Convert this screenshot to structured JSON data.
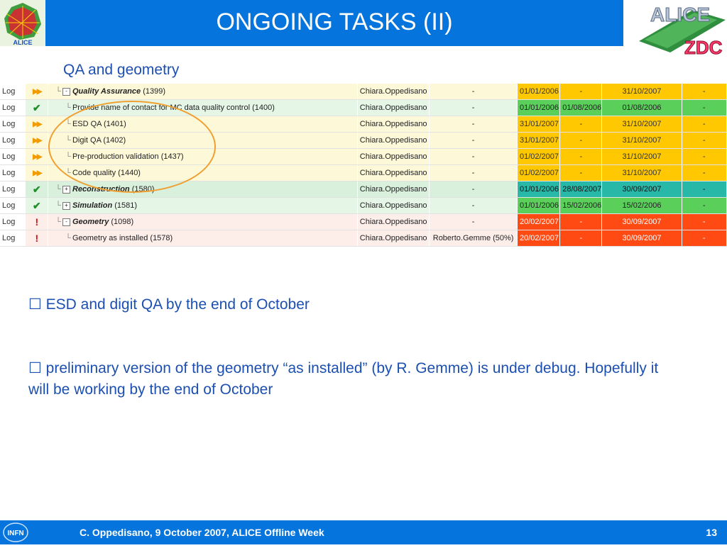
{
  "slide": {
    "title": "ONGOING TASKS (II)",
    "subtitle": "QA and geometry"
  },
  "logos": {
    "left_caption": "ALICE",
    "right_top": "ALICE",
    "right_bottom": "ZDC",
    "footer_logo": "INFN"
  },
  "colors": {
    "title_bar": "#0574dc",
    "text_blue": "#1c4fb1",
    "row_yellow": "#fdf8d8",
    "row_green": "#e6f6e6",
    "row_green_dark": "#d9f0dd",
    "row_pink": "#fdeeea",
    "date_yellow": "#ffc800",
    "date_green": "#5ad05a",
    "date_teal": "#28b8a8",
    "date_red": "#ff4a14"
  },
  "table": {
    "rows": [
      {
        "log": "Log",
        "icon": "fast-forward-icon",
        "indent": 0,
        "expand": "-",
        "name": "Quality Assurance",
        "id": "(1399)",
        "bold": true,
        "owner": "Chiara.Oppedisano",
        "assign": "-",
        "d1": "01/01/2006",
        "d2": "-",
        "d3": "31/10/2007",
        "d4": "-",
        "row_color": "#fdf8d8",
        "date_color": "#ffc800",
        "text_color": "#333333"
      },
      {
        "log": "Log",
        "icon": "check-icon",
        "indent": 1,
        "expand": "",
        "name": "Provide name of contact for MC data quality control",
        "id": "(1400)",
        "bold": false,
        "owner": "Chiara.Oppedisano",
        "assign": "-",
        "d1": "01/01/2006",
        "d2": "01/08/2006",
        "d3": "01/08/2006",
        "d4": "-",
        "row_color": "#e6f6e6",
        "date_color": "#5ad05a",
        "text_color": "#222222"
      },
      {
        "log": "Log",
        "icon": "fast-forward-icon",
        "indent": 1,
        "expand": "",
        "name": "ESD QA",
        "id": "(1401)",
        "bold": false,
        "owner": "Chiara.Oppedisano",
        "assign": "-",
        "d1": "31/01/2007",
        "d2": "-",
        "d3": "31/10/2007",
        "d4": "-",
        "row_color": "#fdf8d8",
        "date_color": "#ffc800",
        "text_color": "#333333"
      },
      {
        "log": "Log",
        "icon": "fast-forward-icon",
        "indent": 1,
        "expand": "",
        "name": "Digit QA",
        "id": "(1402)",
        "bold": false,
        "owner": "Chiara.Oppedisano",
        "assign": "-",
        "d1": "31/01/2007",
        "d2": "-",
        "d3": "31/10/2007",
        "d4": "-",
        "row_color": "#fdf8d8",
        "date_color": "#ffc800",
        "text_color": "#333333"
      },
      {
        "log": "Log",
        "icon": "fast-forward-icon",
        "indent": 1,
        "expand": "",
        "name": "Pre-production validation",
        "id": "(1437)",
        "bold": false,
        "owner": "Chiara.Oppedisano",
        "assign": "-",
        "d1": "01/02/2007",
        "d2": "-",
        "d3": "31/10/2007",
        "d4": "-",
        "row_color": "#fdf8d8",
        "date_color": "#ffc800",
        "text_color": "#333333"
      },
      {
        "log": "Log",
        "icon": "fast-forward-icon",
        "indent": 1,
        "expand": "",
        "name": "Code quality",
        "id": "(1440)",
        "bold": false,
        "owner": "Chiara.Oppedisano",
        "assign": "-",
        "d1": "01/02/2007",
        "d2": "-",
        "d3": "31/10/2007",
        "d4": "-",
        "row_color": "#fdf8d8",
        "date_color": "#ffc800",
        "text_color": "#333333"
      },
      {
        "log": "Log",
        "icon": "check-icon",
        "indent": 0,
        "expand": "+",
        "name": "Reconstruction",
        "id": "(1580)",
        "bold": true,
        "owner": "Chiara.Oppedisano",
        "assign": "-",
        "d1": "01/01/2006",
        "d2": "28/08/2007",
        "d3": "30/09/2007",
        "d4": "-",
        "row_color": "#d9f0dd",
        "date_color": "#28b8a8",
        "text_color": "#111111"
      },
      {
        "log": "Log",
        "icon": "check-icon",
        "indent": 0,
        "expand": "+",
        "name": "Simulation",
        "id": "(1581)",
        "bold": true,
        "owner": "Chiara.Oppedisano",
        "assign": "-",
        "d1": "01/01/2006",
        "d2": "15/02/2006",
        "d3": "15/02/2006",
        "d4": "-",
        "row_color": "#e6f6e6",
        "date_color": "#5ad05a",
        "text_color": "#222222"
      },
      {
        "log": "Log",
        "icon": "exclamation-icon",
        "indent": 0,
        "expand": "-",
        "name": "Geometry",
        "id": "(1098)",
        "bold": true,
        "owner": "Chiara.Oppedisano",
        "assign": "-",
        "d1": "20/02/2007",
        "d2": "-",
        "d3": "30/09/2007",
        "d4": "-",
        "row_color": "#fdeeea",
        "date_color": "#ff4a14",
        "text_color": "#ffffff"
      },
      {
        "log": "Log",
        "icon": "exclamation-icon",
        "indent": 1,
        "expand": "",
        "name": "Geometry as installed",
        "id": "(1578)",
        "bold": false,
        "owner": "Chiara.Oppedisano",
        "assign": "Roberto.Gemme (50%)",
        "d1": "20/02/2007",
        "d2": "-",
        "d3": "30/09/2007",
        "d4": "-",
        "row_color": "#fdeeea",
        "date_color": "#ff4a14",
        "text_color": "#ffffff"
      }
    ]
  },
  "bullets": [
    {
      "prefix": "☐",
      "text": " ESD and digit QA by the end of October"
    },
    {
      "prefix": "☐",
      "text": " preliminary version of the geometry “as installed” (by R. Gemme) is under debug. Hopefully it will be working by the end of October"
    }
  ],
  "footer": {
    "text": "C. Oppedisano, 9 October 2007, ALICE Offline Week",
    "page": "13"
  }
}
